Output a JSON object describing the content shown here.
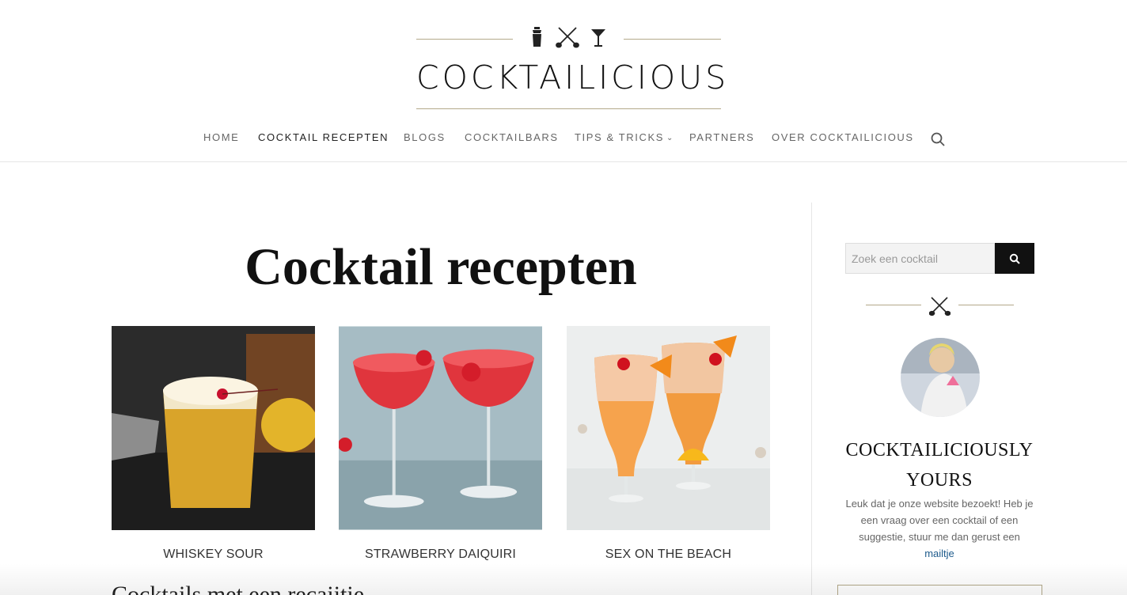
{
  "brand": {
    "logo_text": "COCKTAILICIOUS",
    "accent_color": "#b3a98a",
    "logo_icons": [
      "cocktail-shaker-icon",
      "crossed-spoons-icon",
      "martini-glass-icon"
    ]
  },
  "nav": {
    "items": [
      {
        "label": "HOME"
      },
      {
        "label": "COCKTAIL RECEPTEN",
        "active": true
      },
      {
        "label": "BLOGS"
      },
      {
        "label": "COCKTAILBARS"
      },
      {
        "label": "TIPS & TRICKS",
        "has_dropdown": true
      },
      {
        "label": "PARTNERS"
      },
      {
        "label": "OVER COCKTAILICIOUS"
      }
    ],
    "search_icon": "search-icon"
  },
  "main": {
    "title": "Cocktail recepten",
    "cards": [
      {
        "label": "WHISKEY SOUR"
      },
      {
        "label": "STRAWBERRY DAIQUIRI"
      },
      {
        "label": "SEX ON THE BEACH"
      }
    ],
    "sub_heading": "Cocktails met een recaiitie"
  },
  "sidebar": {
    "search_placeholder": "Zoek een cocktail",
    "search_button_icon": "search-icon",
    "heading": "COCKTAILICIOUSLY YOURS",
    "text": "Leuk dat je onze website bezoekt! Heb je een vraag over een cocktail of een suggestie, stuur me dan gerust een",
    "link_text": "mailtje"
  }
}
